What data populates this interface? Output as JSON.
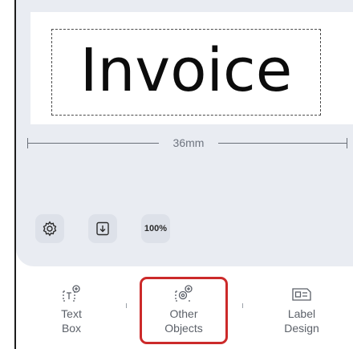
{
  "label": {
    "text": "Invoice",
    "width_label": "36mm"
  },
  "toolbar": {
    "settings_icon": "gear-icon",
    "import_icon": "download-tray-icon",
    "zoom_label": "100%"
  },
  "bottom_nav": {
    "items": [
      {
        "label": "Text\nBox",
        "icon": "text-box-add-icon"
      },
      {
        "label": "Other\nObjects",
        "icon": "other-objects-add-icon",
        "highlighted": true
      },
      {
        "label": "Label\nDesign",
        "icon": "label-design-icon"
      }
    ]
  },
  "colors": {
    "canvas_bg": "#e9ecf2",
    "highlight": "#cc2a2a"
  }
}
